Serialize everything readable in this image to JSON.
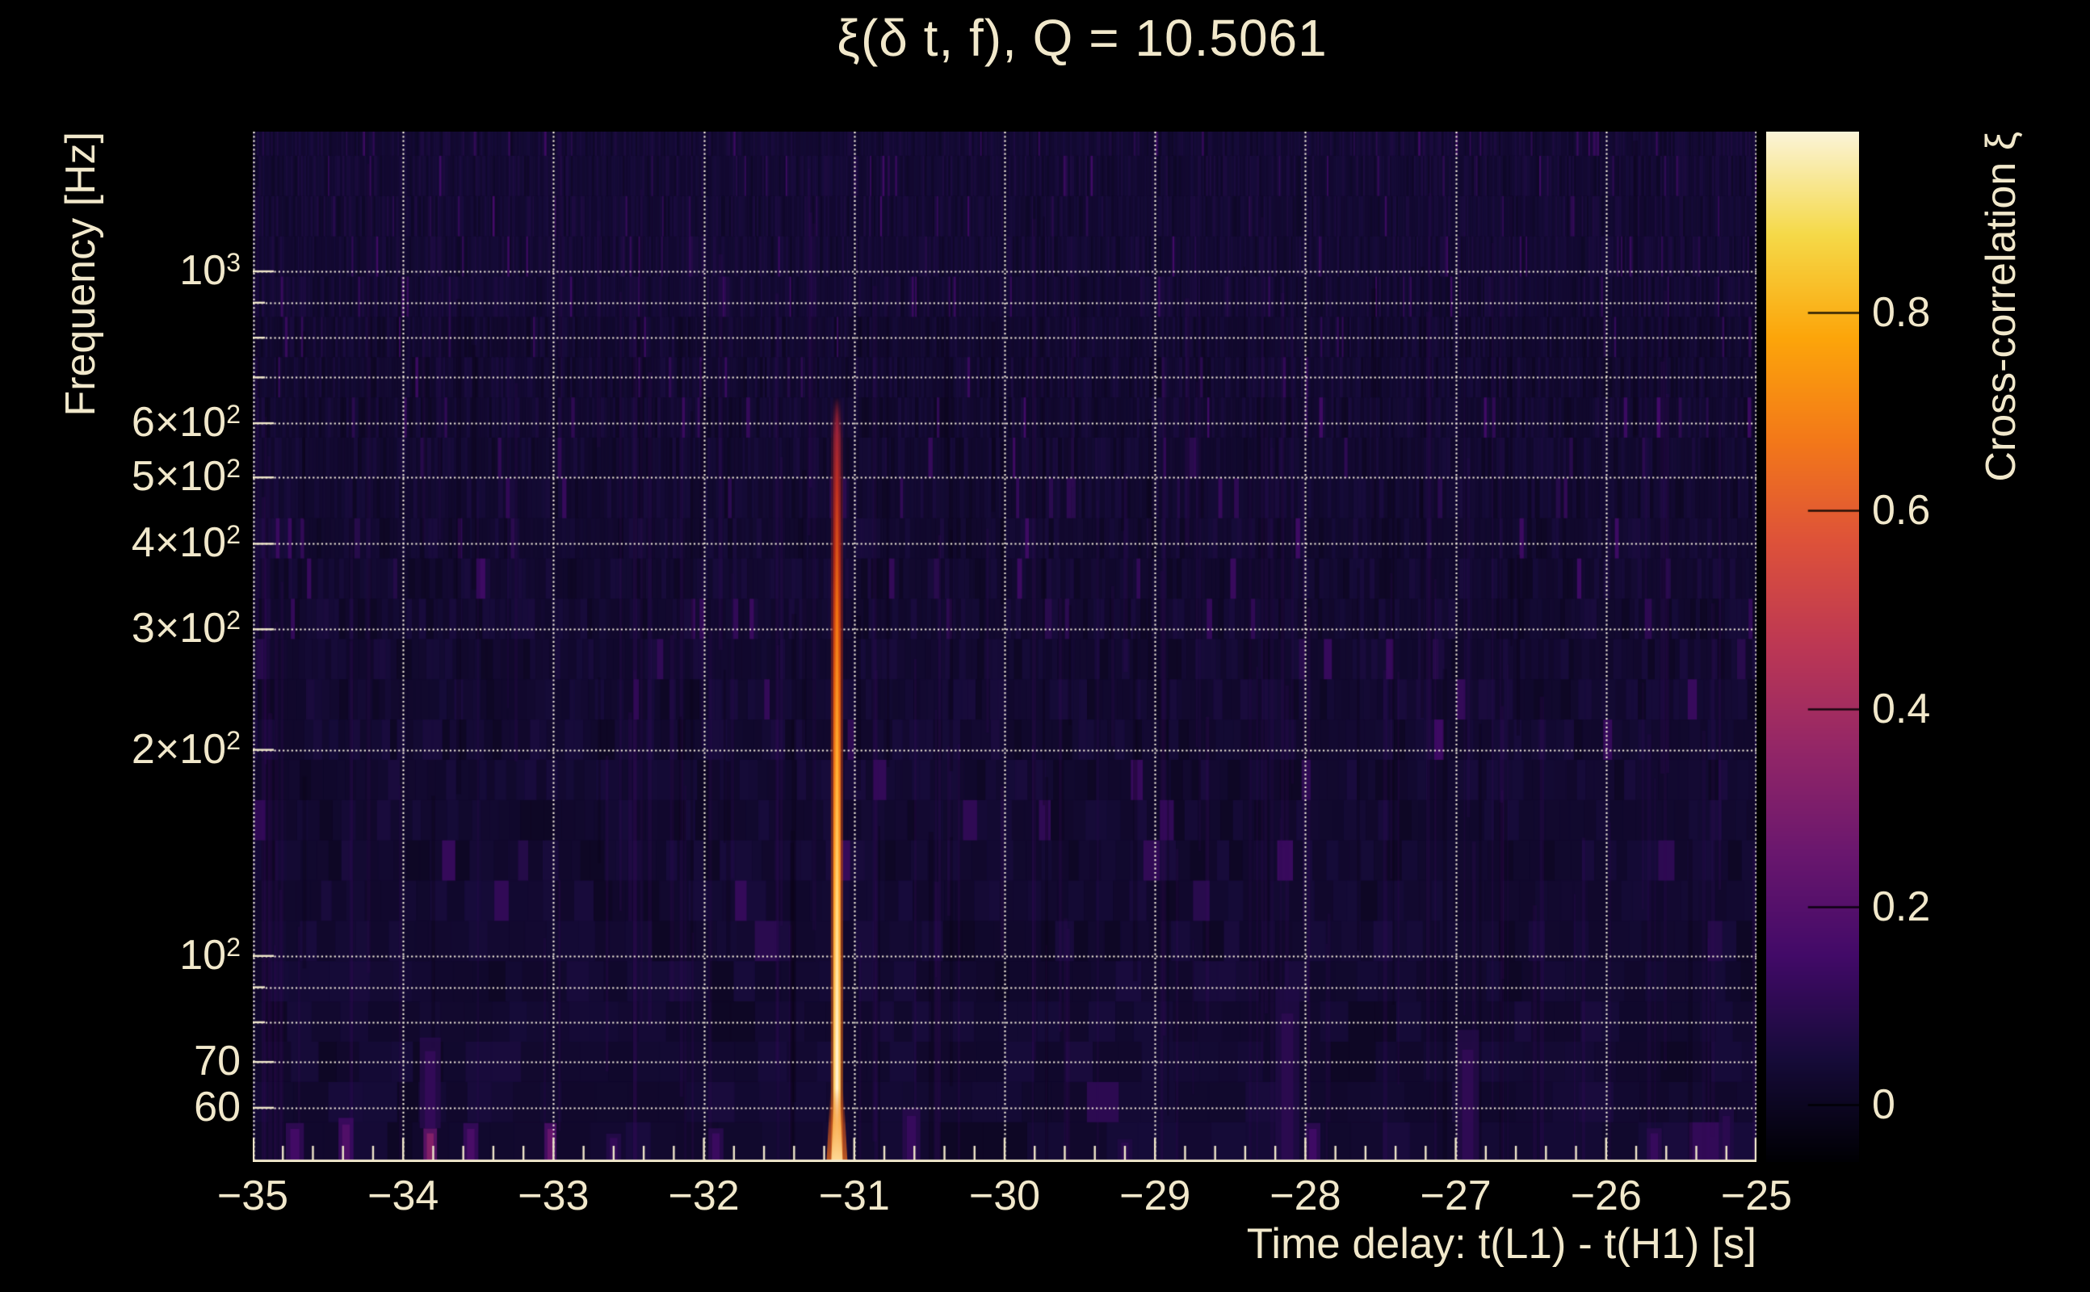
{
  "figure": {
    "title": "ξ(δ t, f), Q = 10.5061",
    "background_color": "#000000",
    "text_color": "#f1e8cb",
    "gridline_color": "#f5eedd"
  },
  "axes": {
    "x": {
      "title": "Time delay: t(L1) - t(H1) [s]",
      "min": -35,
      "max": -25,
      "minor_tick_step": 0.2,
      "ticks": [
        {
          "label": "−35",
          "value": -35
        },
        {
          "label": "−34",
          "value": -34
        },
        {
          "label": "−33",
          "value": -33
        },
        {
          "label": "−32",
          "value": -32
        },
        {
          "label": "−31",
          "value": -31
        },
        {
          "label": "−30",
          "value": -30
        },
        {
          "label": "−29",
          "value": -29
        },
        {
          "label": "−28",
          "value": -28
        },
        {
          "label": "−27",
          "value": -27
        },
        {
          "label": "−26",
          "value": -26
        },
        {
          "label": "−25",
          "value": -25
        }
      ]
    },
    "y": {
      "title": "Frequency [Hz]",
      "scale": "log",
      "min_hz": 50,
      "max_hz": 1600,
      "gridline_values": [
        60,
        70,
        80,
        90,
        100,
        200,
        300,
        400,
        500,
        600,
        700,
        800,
        900,
        1000
      ],
      "ticks": [
        {
          "text": "10",
          "exp": "3",
          "value": 1000
        },
        {
          "text": "6×10",
          "exp": "2",
          "value": 600
        },
        {
          "text": "5×10",
          "exp": "2",
          "value": 500
        },
        {
          "text": "4×10",
          "exp": "2",
          "value": 400
        },
        {
          "text": "3×10",
          "exp": "2",
          "value": 300
        },
        {
          "text": "2×10",
          "exp": "2",
          "value": 200
        },
        {
          "text": "10",
          "exp": "2",
          "value": 100
        },
        {
          "text": "70",
          "exp": "",
          "value": 70
        },
        {
          "text": "60",
          "exp": "",
          "value": 60
        }
      ]
    },
    "colorbar": {
      "title": "Cross-correlation ξ",
      "vmin": -0.058,
      "vmax": 0.983,
      "ticks": [
        {
          "label": "0",
          "value": 0
        },
        {
          "label": "0.2",
          "value": 0.2
        },
        {
          "label": "0.4",
          "value": 0.4
        },
        {
          "label": "0.6",
          "value": 0.6
        },
        {
          "label": "0.8",
          "value": 0.8
        }
      ]
    }
  },
  "chart_data": {
    "type": "heatmap",
    "title": "ξ(δ t, f), Q = 10.5061",
    "q_value": 10.5061,
    "xlabel": "Time delay: t(L1) - t(H1) [s]",
    "ylabel": "Frequency [Hz]",
    "zlabel": "Cross-correlation ξ",
    "x_range_s": [
      -35,
      -25
    ],
    "y_range_hz": [
      50,
      1600
    ],
    "y_scale": "log",
    "z_range": [
      -0.058,
      0.983
    ],
    "background_level": 0.03,
    "peak": {
      "time_delay_s": -31.115,
      "freq_span_hz": [
        50,
        655
      ],
      "xi_max": 0.98
    },
    "secondary_blobs": [
      {
        "t": -34.72,
        "f_lo": 50,
        "f_hi": 57,
        "v": 0.16,
        "w": 0.12
      },
      {
        "t": -34.38,
        "f_lo": 50,
        "f_hi": 58,
        "v": 0.2,
        "w": 0.1
      },
      {
        "t": -33.82,
        "f_lo": 50,
        "f_hi": 56,
        "v": 0.34,
        "w": 0.09
      },
      {
        "t": -33.82,
        "f_lo": 56,
        "f_hi": 76,
        "v": 0.12,
        "w": 0.14
      },
      {
        "t": -33.55,
        "f_lo": 50,
        "f_hi": 57,
        "v": 0.18,
        "w": 0.1
      },
      {
        "t": -33.02,
        "f_lo": 50,
        "f_hi": 57,
        "v": 0.26,
        "w": 0.08
      },
      {
        "t": -32.6,
        "f_lo": 50,
        "f_hi": 55,
        "v": 0.12,
        "w": 0.1
      },
      {
        "t": -31.92,
        "f_lo": 50,
        "f_hi": 56,
        "v": 0.14,
        "w": 0.1
      },
      {
        "t": -30.62,
        "f_lo": 50,
        "f_hi": 60,
        "v": 0.13,
        "w": 0.12
      },
      {
        "t": -29.2,
        "f_lo": 50,
        "f_hi": 54,
        "v": 0.1,
        "w": 0.1
      },
      {
        "t": -28.12,
        "f_lo": 50,
        "f_hi": 90,
        "v": 0.1,
        "w": 0.16
      },
      {
        "t": -27.95,
        "f_lo": 50,
        "f_hi": 57,
        "v": 0.15,
        "w": 0.1
      },
      {
        "t": -26.92,
        "f_lo": 50,
        "f_hi": 78,
        "v": 0.11,
        "w": 0.15
      },
      {
        "t": -25.68,
        "f_lo": 50,
        "f_hi": 56,
        "v": 0.13,
        "w": 0.1
      },
      {
        "t": -25.2,
        "f_lo": 50,
        "f_hi": 60,
        "v": 0.1,
        "w": 0.1
      }
    ],
    "colormap": "inferno",
    "colormap_stops": [
      [
        0.0,
        "#000004"
      ],
      [
        0.1,
        "#160b39"
      ],
      [
        0.2,
        "#420a68"
      ],
      [
        0.3,
        "#6a176e"
      ],
      [
        0.4,
        "#932667"
      ],
      [
        0.5,
        "#bc3754"
      ],
      [
        0.6,
        "#dd513a"
      ],
      [
        0.7,
        "#f37819"
      ],
      [
        0.8,
        "#fca50a"
      ],
      [
        0.9,
        "#f5d948"
      ],
      [
        1.0,
        "#fbf4d8"
      ]
    ]
  }
}
